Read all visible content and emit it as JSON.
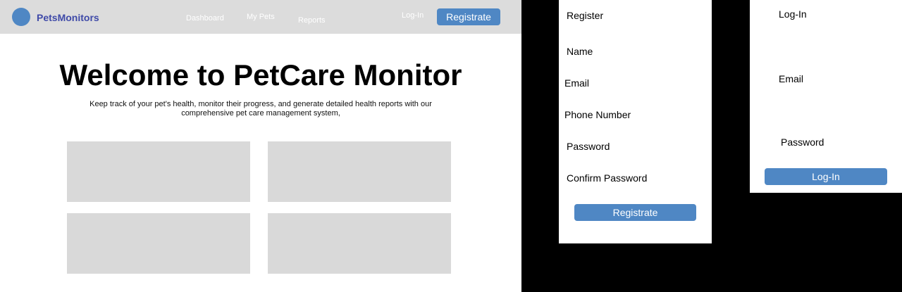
{
  "navbar": {
    "brand": "PetsMonitors",
    "links": [
      "Dashboard",
      "My Pets",
      "Reports"
    ],
    "login_label": "Log-In",
    "register_label": "Registrate"
  },
  "hero": {
    "title": "Welcome to PetCare Monitor",
    "subtitle": "Keep track of your pet's health, monitor their progress, and generate detailed health reports with our comprehensive pet care management system,"
  },
  "register_form": {
    "title": "Register",
    "fields": [
      "Name",
      "Email",
      "Phone Number",
      "Password",
      "Confirm Password"
    ],
    "submit_label": "Registrate"
  },
  "login_form": {
    "title": "Log-In",
    "fields": [
      "Email",
      "Password"
    ],
    "submit_label": "Log-In"
  },
  "colors": {
    "accent": "#4f87c4",
    "brand_text": "#3f4aa8",
    "navbar_bg": "#dcdcdc",
    "card_bg": "#d9d9d9"
  }
}
